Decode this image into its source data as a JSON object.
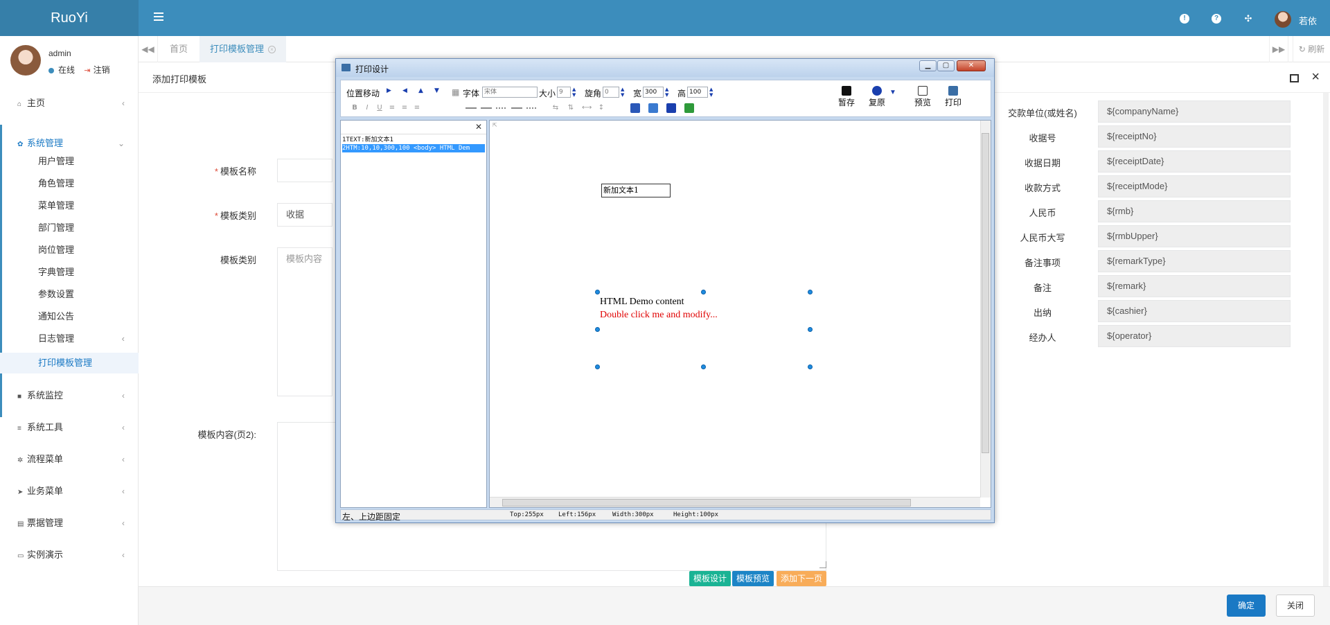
{
  "app": {
    "logo": "RuoYi",
    "user_name": "若依"
  },
  "colors": {
    "primary": "#3c8dbc",
    "accent": "#1a79c4",
    "danger": "#dd4b39",
    "green": "#1ab394",
    "blue": "#23c6c8",
    "orange": "#f8ac59"
  },
  "header_icons": [
    "bell-icon",
    "question-icon",
    "fullscreen-icon"
  ],
  "sidebar": {
    "username": "admin",
    "online": "在线",
    "logout": "注销",
    "menu": [
      {
        "label": "主页",
        "icon": "home-icon"
      },
      {
        "label": "系统管理",
        "icon": "gear-icon"
      },
      {
        "label": "系统监控",
        "icon": "video-icon"
      },
      {
        "label": "系统工具",
        "icon": "bars-icon"
      },
      {
        "label": "流程菜单",
        "icon": "cogs-icon"
      },
      {
        "label": "业务菜单",
        "icon": "send-icon"
      },
      {
        "label": "票据管理",
        "icon": "keyboard-icon"
      },
      {
        "label": "实例演示",
        "icon": "desktop-icon"
      }
    ],
    "sub_items": [
      "用户管理",
      "角色管理",
      "菜单管理",
      "部门管理",
      "岗位管理",
      "字典管理",
      "参数设置",
      "通知公告",
      "日志管理",
      "打印模板管理"
    ]
  },
  "tabs": {
    "home": "首页",
    "active": "打印模板管理",
    "refresh": "刷新"
  },
  "page": {
    "title": "添加打印模板",
    "labels": {
      "name": "模板名称",
      "type": "模板类别",
      "content": "模板类别",
      "content2": "模板内容(页2):"
    },
    "type_value": "收据",
    "content_placeholder": "模板内容",
    "buttons": {
      "design": "模板设计",
      "preview": "模板预览",
      "add_page": "添加下一页"
    },
    "ok": "确定",
    "close": "关闭"
  },
  "fields": [
    {
      "label": "交款单位(或姓名)",
      "value": "${companyName}"
    },
    {
      "label": "收据号",
      "value": "${receiptNo}"
    },
    {
      "label": "收据日期",
      "value": "${receiptDate}"
    },
    {
      "label": "收款方式",
      "value": "${receiptMode}"
    },
    {
      "label": "人民币",
      "value": "${rmb}"
    },
    {
      "label": "人民币大写",
      "value": "${rmbUpper}"
    },
    {
      "label": "备注事项",
      "value": "${remarkType}"
    },
    {
      "label": "备注",
      "value": "${remark}"
    },
    {
      "label": "出纳",
      "value": "${cashier}"
    },
    {
      "label": "经办人",
      "value": "${operator}"
    }
  ],
  "print_window": {
    "title": "打印设计",
    "toolbar": {
      "move": "位置移动",
      "font_label": "字体",
      "font_value": "宋体",
      "size_label": "大小",
      "size_value": "9",
      "rotate_label": "旋角",
      "rotate_value": "0",
      "width_label": "宽",
      "width_value": "300",
      "height_label": "高",
      "height_value": "100",
      "save": "暂存",
      "restore": "复原",
      "preview": "预览",
      "print": "打印"
    },
    "list": [
      "1TEXT:新加文本1",
      "2HTM:10,10,300,100 <body> HTML Dem"
    ],
    "canvas": {
      "text_item": "新加文本1",
      "html_line1": "HTML Demo content",
      "html_line2": "Double click me and modify..."
    },
    "status": {
      "anchor": "左、上边距固定",
      "top": "Top:255px",
      "left": "Left:156px",
      "width": "Width:300px",
      "height": "Height:100px"
    }
  }
}
